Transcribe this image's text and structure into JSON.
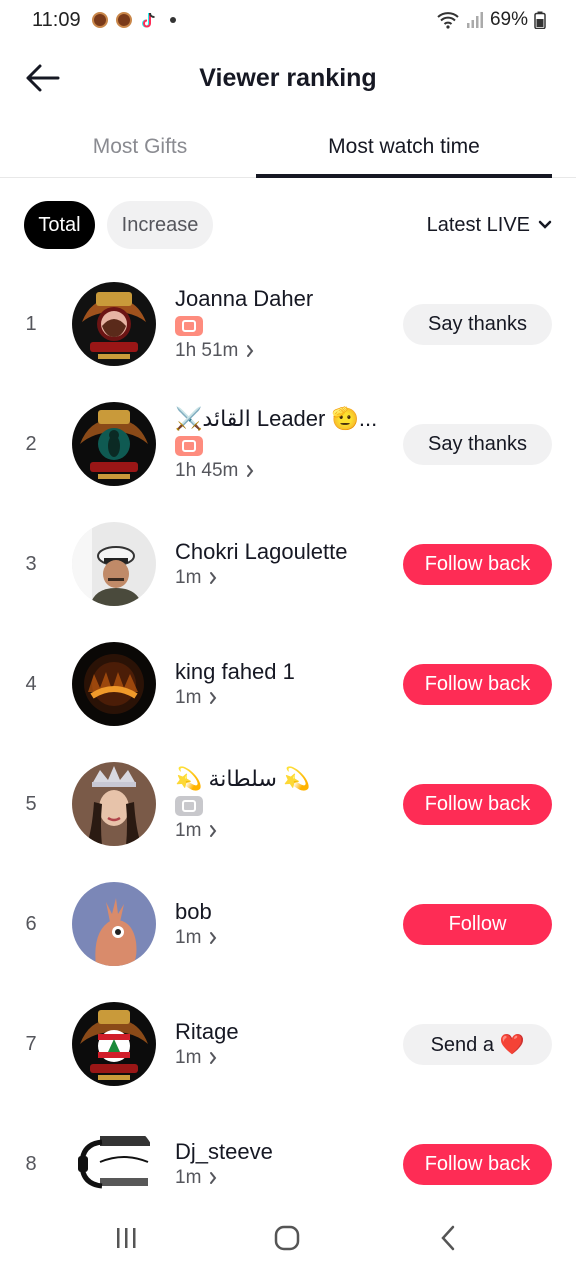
{
  "status_bar": {
    "time": "11:09",
    "battery": "69%"
  },
  "header": {
    "title": "Viewer ranking"
  },
  "tabs": [
    {
      "label": "Most Gifts",
      "active": false
    },
    {
      "label": "Most watch time",
      "active": true
    }
  ],
  "filters": {
    "total": "Total",
    "increase": "Increase",
    "sort": "Latest LIVE"
  },
  "viewers": [
    {
      "rank": "1",
      "name": "Joanna Daher",
      "badge": "orange",
      "duration": "1h 51m",
      "action": "Say thanks",
      "avatar": "crest-photo"
    },
    {
      "rank": "2",
      "name": "⚔️القائد Leader 🫡...",
      "badge": "orange",
      "duration": "1h 45m",
      "action": "Say thanks",
      "avatar": "crest-green"
    },
    {
      "rank": "3",
      "name": "Chokri Lagoulette",
      "badge": null,
      "duration": "1m",
      "action": "Follow back",
      "avatar": "captain-photo"
    },
    {
      "rank": "4",
      "name": "king fahed 1",
      "badge": null,
      "duration": "1m",
      "action": "Follow back",
      "avatar": "king-logo"
    },
    {
      "rank": "5",
      "name": "💫 سلطانة 💫",
      "badge": "grey",
      "duration": "1m",
      "action": "Follow back",
      "avatar": "queen-photo"
    },
    {
      "rank": "6",
      "name": "bob",
      "badge": null,
      "duration": "1m",
      "action": "Follow",
      "avatar": "default-avatar"
    },
    {
      "rank": "7",
      "name": "Ritage",
      "badge": null,
      "duration": "1m",
      "action": "Send a ❤️",
      "avatar": "crest-cedar"
    },
    {
      "rank": "8",
      "name": "Dj_steeve",
      "badge": null,
      "duration": "1m",
      "action": "Follow back",
      "avatar": "dj-logo"
    }
  ],
  "colors": {
    "accent": "#fe2c55",
    "chip_active": "#000000",
    "chip_inactive": "#f1f1f2",
    "text_secondary": "#55565c"
  }
}
